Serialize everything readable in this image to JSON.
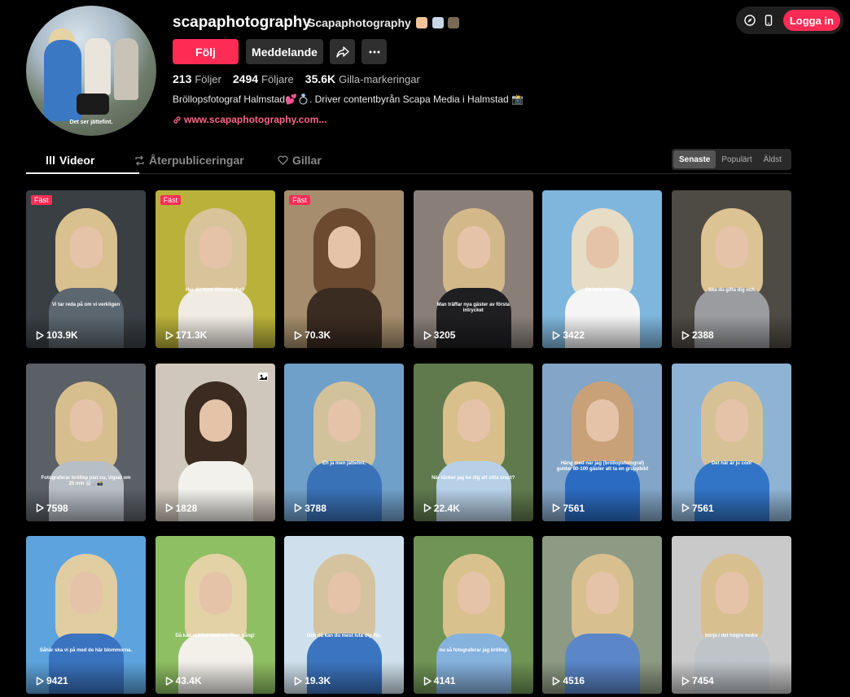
{
  "top_controls": {
    "icons": [
      "compass-icon",
      "phone-icon"
    ],
    "login_label": "Logga in"
  },
  "profile": {
    "username": "scapaphotography",
    "nickname": "Scapaphotography",
    "nickname_emojis": [
      "woman-emoji",
      "ring-emoji",
      "camera-emoji"
    ],
    "avatar_caption": "Det ser jättefint.",
    "follow_label": "Följ",
    "message_label": "Meddelande",
    "stats": [
      {
        "value": "213",
        "label": "Följer"
      },
      {
        "value": "2494",
        "label": "Följare"
      },
      {
        "value": "35.6K",
        "label": "Gilla-markeringar"
      }
    ],
    "bio": "Bröllopsfotograf Halmstad💕💍. Driver contentbyrån Scapa Media i Halmstad 📸",
    "link": "www.scapaphotography.com..."
  },
  "tabs": [
    {
      "label": "Videor",
      "icon": "grid-icon",
      "active": true
    },
    {
      "label": "Återpubliceringar",
      "icon": "repost-icon",
      "active": false
    },
    {
      "label": "Gillar",
      "icon": "heart-icon",
      "active": false
    }
  ],
  "sort": [
    {
      "label": "Senaste",
      "active": true
    },
    {
      "label": "Populärt",
      "active": false
    },
    {
      "label": "Äldst",
      "active": false
    }
  ],
  "pinned_label": "Fäst",
  "videos": [
    {
      "views": "103.9K",
      "pinned": true,
      "bg": "#3a3f44",
      "hair": "#d9c08f",
      "body": "#5c6770",
      "caption": "Vi tar reda på om vi verkligen"
    },
    {
      "views": "171.3K",
      "pinned": true,
      "bg": "#b9b23a",
      "hair": "#d8c49a",
      "body": "#f0ece4",
      "caption": "Har du nyss förlovat dig?"
    },
    {
      "views": "70.3K",
      "pinned": true,
      "bg": "#a58d6d",
      "hair": "#6b4a30",
      "body": "#3b2c22",
      "caption": ""
    },
    {
      "views": "3205",
      "pinned": false,
      "bg": "#8a7f78",
      "hair": "#d3b98a",
      "body": "#1f1f22",
      "caption": "Man träffar nya gäster av första intrycket"
    },
    {
      "views": "3422",
      "pinned": false,
      "bg": "#7fb6dd",
      "hair": "#e7dcc6",
      "body": "#f5f5f5",
      "caption": "Se hela videon"
    },
    {
      "views": "2388",
      "pinned": false,
      "bg": "#4e4a44",
      "hair": "#dcc393",
      "body": "#9b9ca0",
      "caption": "Ska du gifta dig och"
    },
    {
      "views": "7598",
      "pinned": false,
      "bg": "#5b6066",
      "hair": "#d7be8f",
      "body": "#b8bec5",
      "caption": "Fotograferar bröllop just nu, vigsel om 25 min 😅💍📸"
    },
    {
      "views": "1828",
      "pinned": false,
      "bg": "#cfc7bb",
      "hair": "#3b2b21",
      "body": "#f3f1ec",
      "caption": ""
    },
    {
      "views": "3788",
      "pinned": false,
      "bg": "#6fa0c9",
      "hair": "#d2c29b",
      "body": "#3a72b8",
      "caption": "Eh ja men jättefint."
    },
    {
      "views": "22.4K",
      "pinned": false,
      "bg": "#607a4d",
      "hair": "#d8bf8b",
      "body": "#b7d0e7",
      "caption": "När tänker jag be dig att sitta snart?"
    },
    {
      "views": "7561",
      "pinned": false,
      "bg": "#83a5c7",
      "hair": "#c9a178",
      "body": "#2b6cc2",
      "caption": "Häng med när jag (bröllopsfotograf) guidar 80-100 gäster att ta en gruppbild"
    },
    {
      "views": "7561",
      "pinned": false,
      "bg": "#8fb3d4",
      "hair": "#d6c196",
      "body": "#3275c7",
      "caption": "Det här är ju cool"
    },
    {
      "views": "9421",
      "pinned": false,
      "bg": "#5da4df",
      "hair": "#e0cda1",
      "body": "#3a73bf",
      "caption": "Såhär ska vi på med de här blommorna."
    },
    {
      "views": "43.4K",
      "pinned": false,
      "bg": "#8fbf63",
      "hair": "#e3d2a6",
      "body": "#f3f0ea",
      "caption": "Då kan vi köra med era liten gång!"
    },
    {
      "views": "19.3K",
      "pinned": false,
      "bg": "#cfe0ec",
      "hair": "#d4c39e",
      "body": "#3b74c0",
      "caption": "Och då kan du mest luta dig lite."
    },
    {
      "views": "4141",
      "pinned": false,
      "bg": "#6f9455",
      "hair": "#d9c18e",
      "body": "#86b2de",
      "caption": "nu så fotograferar jag bröllop"
    },
    {
      "views": "4516",
      "pinned": false,
      "bg": "#8d9a84",
      "hair": "#d8bf8f",
      "body": "#5b87c9",
      "caption": ""
    },
    {
      "views": "7454",
      "pinned": false,
      "bg": "#c9c9c9",
      "hair": "#d8bf8f",
      "body": "#bfc4c9",
      "caption": "börja i det högre nedre"
    }
  ]
}
